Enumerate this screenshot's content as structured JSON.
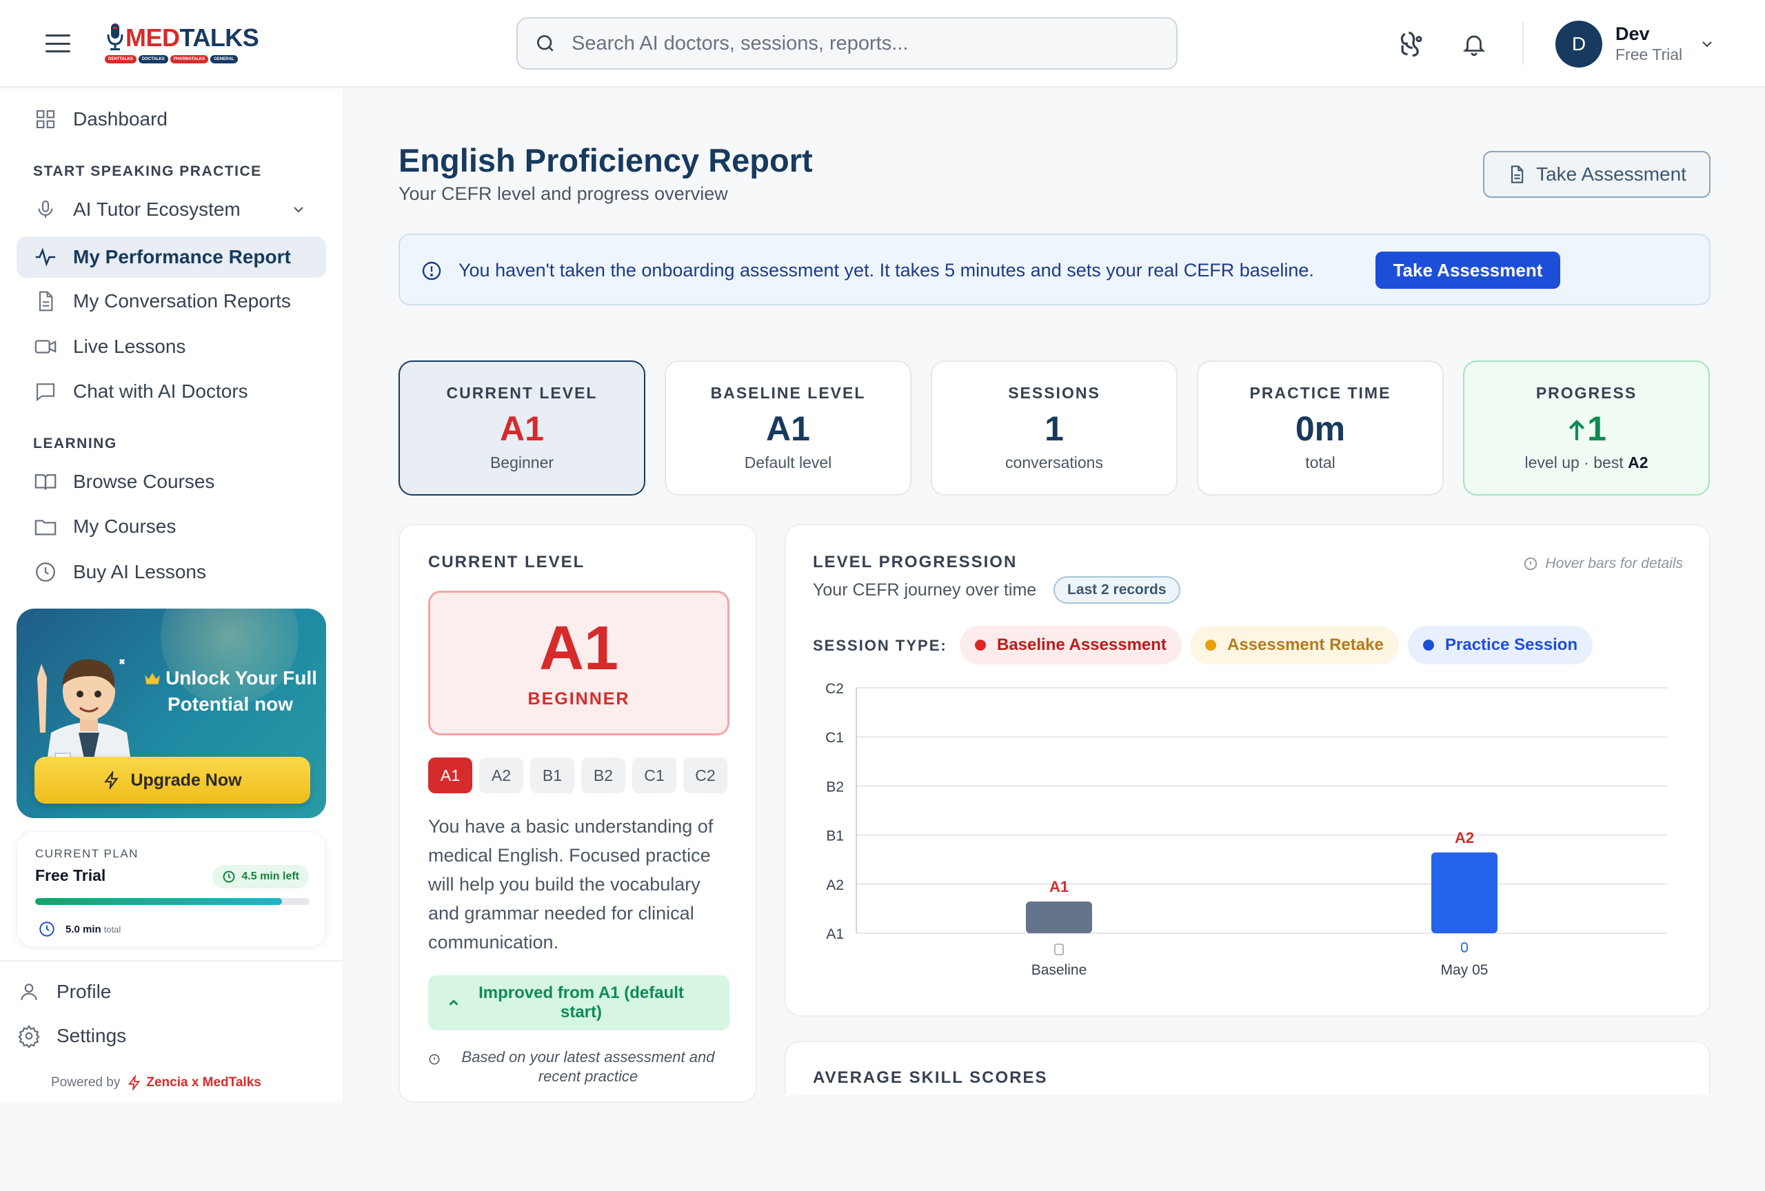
{
  "header": {
    "logo_brand": "MEDTALKS",
    "logo_brand_prefix": "MED",
    "logo_brand_suffix": "TALKS",
    "logo_pills": [
      "DENTTALKS",
      "DOCTALKS",
      "PHARMATALKS",
      "GENERAL"
    ],
    "search_placeholder": "Search AI doctors, sessions, reports...",
    "user_initial": "D",
    "user_name": "Dev",
    "user_plan": "Free Trial"
  },
  "sidebar": {
    "dashboard": "Dashboard",
    "section_speaking": "START SPEAKING PRACTICE",
    "ai_tutor": "AI Tutor Ecosystem",
    "performance": "My Performance Report",
    "conversation_reports": "My Conversation Reports",
    "live_lessons": "Live Lessons",
    "chat_doctors": "Chat with AI Doctors",
    "section_learning": "LEARNING",
    "browse_courses": "Browse Courses",
    "my_courses": "My Courses",
    "buy_lessons": "Buy AI Lessons",
    "promo_title": "Unlock Your Full Potential now",
    "upgrade_label": "Upgrade Now",
    "plan_label": "CURRENT PLAN",
    "plan_name": "Free Trial",
    "plan_left": "4.5 min left",
    "plan_used_fraction": 0.9,
    "plan_total_value": "5.0 min",
    "plan_total_suffix": "total",
    "profile": "Profile",
    "settings": "Settings",
    "powered_by": "Powered by",
    "powered_brand": "Zencia x MedTalks"
  },
  "main": {
    "title": "English Proficiency Report",
    "subtitle": "Your CEFR level and progress overview",
    "take_assessment": "Take Assessment",
    "alert_message": "You haven't taken the onboarding assessment yet. It takes 5 minutes and sets your real CEFR baseline.",
    "alert_button": "Take Assessment",
    "stats": [
      {
        "label": "CURRENT LEVEL",
        "value": "A1",
        "caption": "Beginner"
      },
      {
        "label": "BASELINE LEVEL",
        "value": "A1",
        "caption": "Default level"
      },
      {
        "label": "SESSIONS",
        "value": "1",
        "caption": "conversations"
      },
      {
        "label": "PRACTICE TIME",
        "value": "0m",
        "caption": "total"
      },
      {
        "label": "PROGRESS",
        "value": "1",
        "caption": "level up · best",
        "caption_strong": "A2"
      }
    ],
    "current_level_card": {
      "title": "CURRENT LEVEL",
      "level": "A1",
      "level_name": "BEGINNER",
      "chips": [
        "A1",
        "A2",
        "B1",
        "B2",
        "C1",
        "C2"
      ],
      "description": "You have a basic understanding of medical English. Focused practice will help you build the vocabulary and grammar needed for clinical communication.",
      "improved": "Improved from A1 (default start)",
      "note": "Based on your latest assessment and recent practice"
    },
    "progression_card": {
      "title": "LEVEL PROGRESSION",
      "subtitle": "Your CEFR journey over time",
      "records_badge": "Last 2 records",
      "hover_hint": "Hover bars for details",
      "session_type_label": "SESSION TYPE:",
      "legend": [
        {
          "label": "Baseline Assessment",
          "color": "#dc2626",
          "bg": "#fdecec"
        },
        {
          "label": "Assessment Retake",
          "color": "#e8a10c",
          "bg": "#fdf6e3"
        },
        {
          "label": "Practice Session",
          "color": "#1d4ed8",
          "bg": "#e9f0fd"
        }
      ]
    },
    "skills_card_title": "AVERAGE SKILL SCORES"
  },
  "chart_data": {
    "type": "bar",
    "y_levels": [
      "A1",
      "A2",
      "B1",
      "B2",
      "C1",
      "C2"
    ],
    "categories": [
      "Baseline",
      "May 05"
    ],
    "values": [
      "A1",
      "A2"
    ],
    "bar_colors": [
      "#64748b",
      "#2563eb"
    ],
    "value_label_color": "#d62b2b",
    "grid": true
  },
  "colors": {
    "brand_navy": "#173a5e",
    "brand_red": "#d62b2b",
    "success": "#0f8a55",
    "primary_blue": "#1d4ed8"
  }
}
